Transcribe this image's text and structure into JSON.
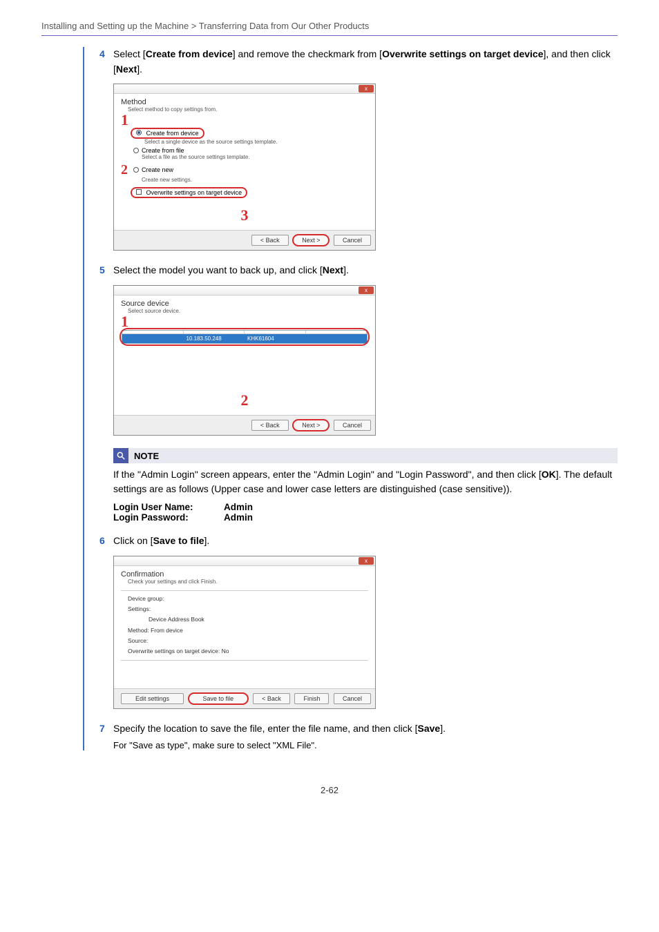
{
  "breadcrumb": "Installing and Setting up the Machine > Transferring Data from Our Other Products",
  "steps": {
    "s4": {
      "num": "4",
      "text_parts": {
        "a": "Select [",
        "b": "Create from device",
        "c": "] and remove the checkmark from [",
        "d": "Overwrite settings on target device",
        "e": "], and then click [",
        "f": "Next",
        "g": "]."
      }
    },
    "s5": {
      "num": "5",
      "text_parts": {
        "a": "Select the model you want to back up, and click [",
        "b": "Next",
        "c": "]."
      }
    },
    "s6": {
      "num": "6",
      "text_parts": {
        "a": "Click on [",
        "b": "Save to file",
        "c": "]."
      }
    },
    "s7": {
      "num": "7",
      "text_parts": {
        "a": "Specify the location to save the file, enter the file name, and then click [",
        "b": "Save",
        "c": "]."
      },
      "sub": "For \"Save as type\", make sure to select \"XML File\"."
    }
  },
  "note": {
    "label": "NOTE",
    "text_parts": {
      "a": "If the \"Admin Login\" screen appears, enter the \"Admin Login\" and \"Login Password\", and then click [",
      "b": "OK",
      "c": "]. The default settings are as follows (Upper case and lower case letters are distinguished (case sensitive))."
    },
    "login": {
      "user_k": "Login User Name:",
      "user_v": "Admin",
      "pass_k": "Login Password:",
      "pass_v": "Admin"
    }
  },
  "shot1": {
    "heading": "Method",
    "sub": "Select method to copy settings from.",
    "m1": "1",
    "opt1": "Create from device",
    "opt1_sub": "Select a single device as the source settings template.",
    "opt2": "Create from file",
    "opt2_sub": "Select a file as the source settings template.",
    "m2": "2",
    "opt3": "Create new",
    "opt3_sub": "Create new settings.",
    "chk": "Overwrite settings on target device",
    "m3": "3",
    "back": "< Back",
    "next": "Next >",
    "cancel": "Cancel"
  },
  "shot2": {
    "heading": "Source device",
    "sub": "Select source device.",
    "m1": "1",
    "ip": "10.183.50.248",
    "serial": "KHK61604",
    "m2": "2",
    "back": "< Back",
    "next": "Next >",
    "cancel": "Cancel"
  },
  "shot3": {
    "heading": "Confirmation",
    "sub": "Check your settings and click Finish.",
    "l1": "Device group:",
    "l2_k": "Settings:",
    "l2_v": "Device Address Book",
    "l3": "Method: From device",
    "l4": "Source:",
    "l5": "Overwrite settings on target device: No",
    "edit": "Edit settings",
    "save": "Save to file",
    "back": "< Back",
    "finish": "Finish",
    "cancel": "Cancel"
  },
  "page_num": "2-62"
}
